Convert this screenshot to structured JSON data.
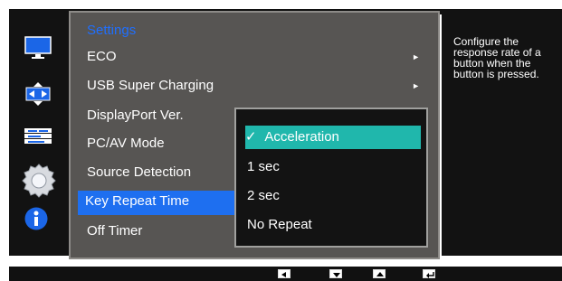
{
  "settings": {
    "title": "Settings",
    "items": [
      {
        "label": "ECO"
      },
      {
        "label": "USB Super Charging"
      },
      {
        "label": "DisplayPort Ver."
      },
      {
        "label": "PC/AV Mode"
      },
      {
        "label": "Source Detection"
      },
      {
        "label": "Key Repeat Time"
      },
      {
        "label": "Off Timer"
      }
    ],
    "submenu_arrow": "►"
  },
  "popup": {
    "options": [
      {
        "label": "Acceleration",
        "selected": true
      },
      {
        "label": "1 sec"
      },
      {
        "label": "2 sec"
      },
      {
        "label": "No Repeat"
      }
    ],
    "check": "✓"
  },
  "help": {
    "text": "Configure the response rate of a button when the button is pressed."
  },
  "icons": [
    "monitor-icon",
    "resize-icon",
    "menu-icon",
    "gear-icon",
    "info-icon"
  ],
  "colors": {
    "selection_blue": "#1e6ff0",
    "popup_selection_teal": "#20b7ac",
    "title_blue": "#1f6fff"
  }
}
